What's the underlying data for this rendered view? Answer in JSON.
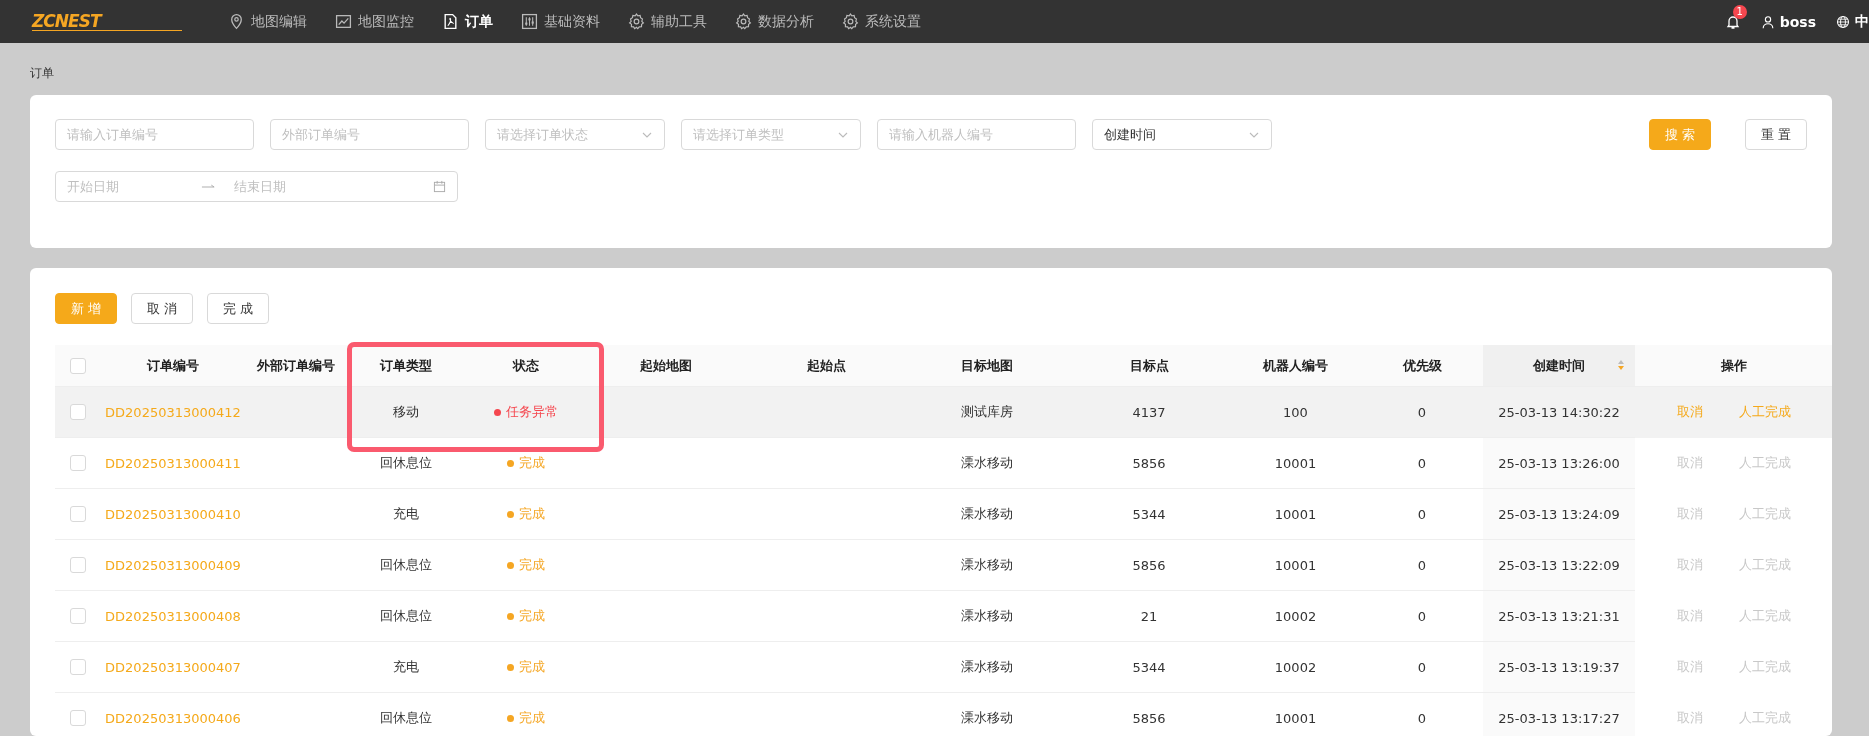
{
  "top_bar": {
    "logo": "ZCNEST",
    "nav": [
      {
        "label": "地图编辑",
        "selected": false
      },
      {
        "label": "地图监控",
        "selected": false
      },
      {
        "label": "订单",
        "selected": true
      },
      {
        "label": "基础资料",
        "selected": false
      },
      {
        "label": "辅助工具",
        "selected": false
      },
      {
        "label": "数据分析",
        "selected": false
      },
      {
        "label": "系统设置",
        "selected": false
      }
    ],
    "notification_count": "1",
    "user": "boss",
    "language": "中"
  },
  "breadcrumb": "订单",
  "filters": {
    "fields": [
      {
        "kind": "input",
        "placeholder": "请输入订单编号"
      },
      {
        "kind": "input",
        "placeholder": "外部订单编号"
      },
      {
        "kind": "select",
        "placeholder": "请选择订单状态"
      },
      {
        "kind": "select",
        "placeholder": "请选择订单类型"
      },
      {
        "kind": "input",
        "placeholder": "请输入机器人编号"
      },
      {
        "kind": "select",
        "value": "创建时间"
      }
    ],
    "date_range": {
      "start_placeholder": "开始日期",
      "end_placeholder": "结束日期"
    },
    "search_button": "搜 索",
    "reset_button": "重 置"
  },
  "toolbar": {
    "buttons": [
      {
        "label": "新 增",
        "kind": "primary"
      },
      {
        "label": "取 消",
        "kind": "default"
      },
      {
        "label": "完 成",
        "kind": "default"
      }
    ]
  },
  "table": {
    "all_checked": false,
    "columns": [
      {
        "label": "订单编号"
      },
      {
        "label": "外部订单编号"
      },
      {
        "label": "订单类型"
      },
      {
        "label": "状态"
      },
      {
        "label": "起始地图"
      },
      {
        "label": "起始点"
      },
      {
        "label": "目标地图"
      },
      {
        "label": "目标点"
      },
      {
        "label": "机器人编号"
      },
      {
        "label": "优先级"
      },
      {
        "label": "创建时间",
        "sorted": true
      },
      {
        "label": "操作"
      }
    ],
    "rows": [
      {
        "checked": false,
        "highlighted": true,
        "order_no": "DD20250313000412",
        "type": "移动",
        "status": "任务异常",
        "color": "#f5474f",
        "target_map": "测试库房",
        "target_point": "4137",
        "robot": "100",
        "priority": "0",
        "created": "25-03-13 14:30:22",
        "actions": [
          "取消",
          "人工完成"
        ],
        "actions_disabled": false
      },
      {
        "checked": false,
        "highlighted": false,
        "order_no": "DD20250313000411",
        "type": "回休息位",
        "status": "完成",
        "color": "#f5a623",
        "target_map": "溧水移动",
        "target_point": "5856",
        "robot": "10001",
        "priority": "0",
        "created": "25-03-13 13:26:00",
        "actions": [
          "取消",
          "人工完成"
        ],
        "actions_disabled": true
      },
      {
        "checked": false,
        "highlighted": false,
        "order_no": "DD20250313000410",
        "type": "充电",
        "status": "完成",
        "color": "#f5a623",
        "target_map": "溧水移动",
        "target_point": "5344",
        "robot": "10001",
        "priority": "0",
        "created": "25-03-13 13:24:09",
        "actions": [
          "取消",
          "人工完成"
        ],
        "actions_disabled": true
      },
      {
        "checked": false,
        "highlighted": false,
        "order_no": "DD20250313000409",
        "type": "回休息位",
        "status": "完成",
        "color": "#f5a623",
        "target_map": "溧水移动",
        "target_point": "5856",
        "robot": "10001",
        "priority": "0",
        "created": "25-03-13 13:22:09",
        "actions": [
          "取消",
          "人工完成"
        ],
        "actions_disabled": true
      },
      {
        "checked": false,
        "highlighted": false,
        "order_no": "DD20250313000408",
        "type": "回休息位",
        "status": "完成",
        "color": "#f5a623",
        "target_map": "溧水移动",
        "target_point": "21",
        "robot": "10002",
        "priority": "0",
        "created": "25-03-13 13:21:31",
        "actions": [
          "取消",
          "人工完成"
        ],
        "actions_disabled": true
      },
      {
        "checked": false,
        "highlighted": false,
        "order_no": "DD20250313000407",
        "type": "充电",
        "status": "完成",
        "color": "#f5a623",
        "target_map": "溧水移动",
        "target_point": "5344",
        "robot": "10002",
        "priority": "0",
        "created": "25-03-13 13:19:37",
        "actions": [
          "取消",
          "人工完成"
        ],
        "actions_disabled": true
      },
      {
        "checked": false,
        "highlighted": false,
        "order_no": "DD20250313000406",
        "type": "回休息位",
        "status": "完成",
        "color": "#f5a623",
        "target_map": "溧水移动",
        "target_point": "5856",
        "robot": "10001",
        "priority": "0",
        "created": "25-03-13 13:17:27",
        "actions": [
          "取消",
          "人工完成"
        ],
        "actions_disabled": true
      }
    ]
  },
  "annotation": {
    "kind": "frame"
  }
}
